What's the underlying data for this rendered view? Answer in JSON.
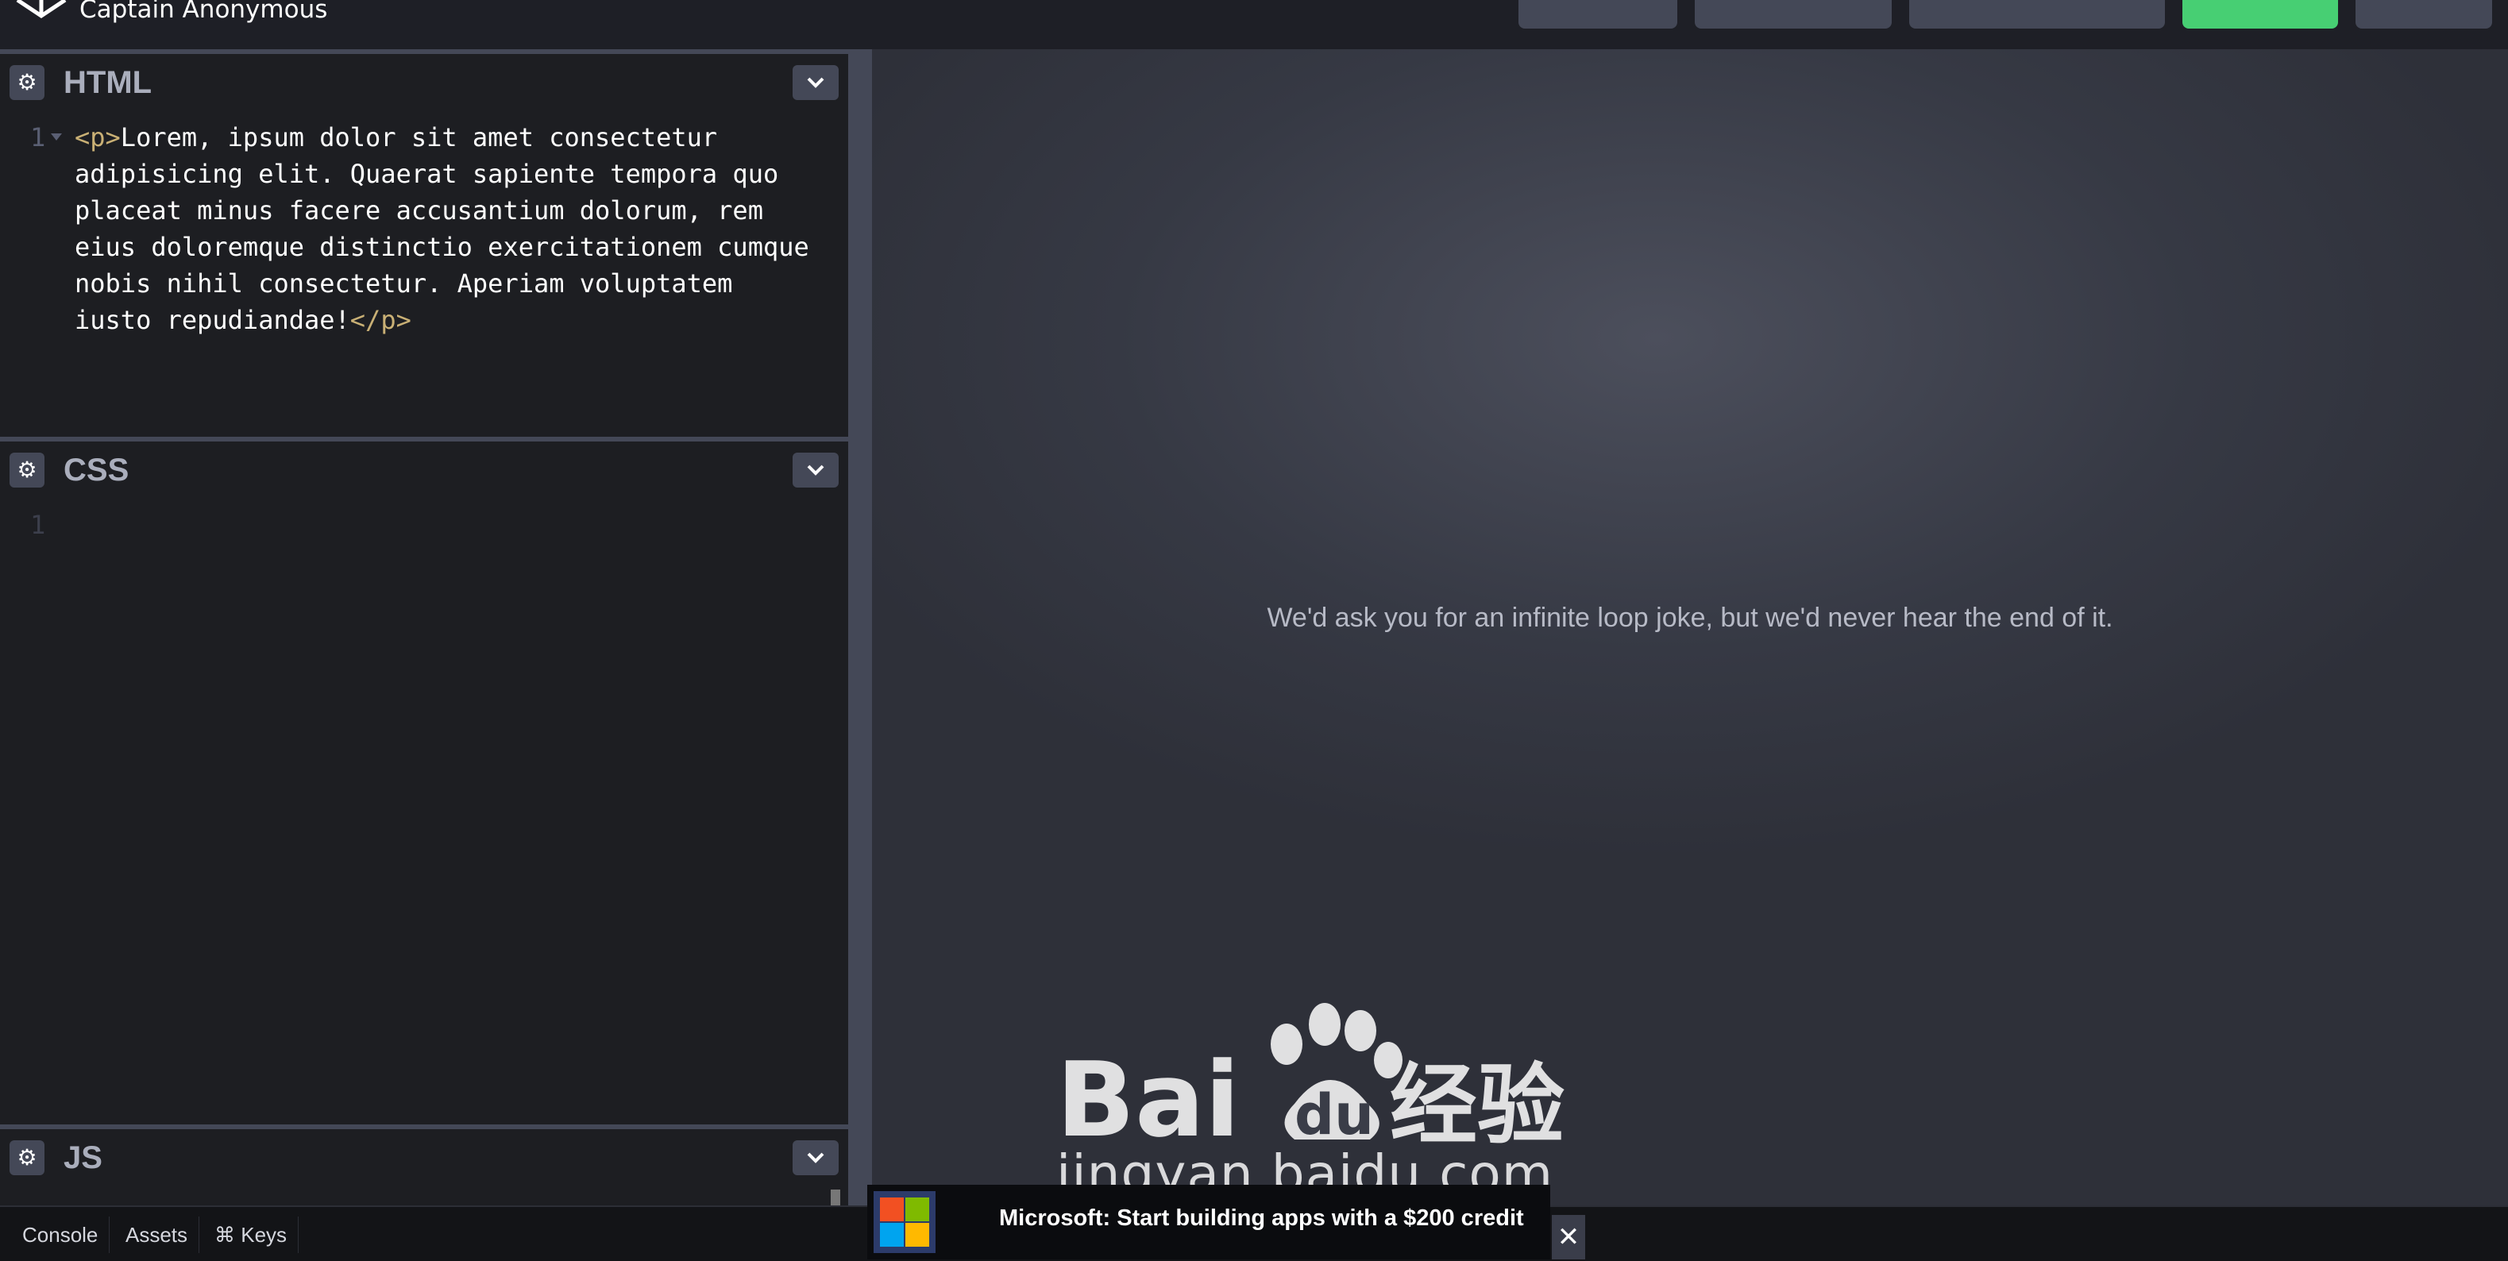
{
  "topbar": {
    "author": "Captain Anonymous"
  },
  "editors": [
    {
      "title": "HTML",
      "lines": [
        {
          "number": "1",
          "open_tag": "<p>",
          "text": "Lorem, ipsum dolor sit amet consectetur adipisicing elit. Quaerat sapiente tempora quo placeat minus facere accusantium dolorum, rem eius doloremque distinctio exercitationem cumque nobis nihil consectetur. Aperiam voluptatem iusto repudiandae!",
          "close_tag": "</p>"
        }
      ]
    },
    {
      "title": "CSS",
      "lines": [
        {
          "number": "1"
        }
      ]
    },
    {
      "title": "JS"
    }
  ],
  "preview": {
    "message": "We'd ask you for an infinite loop joke, but we'd never hear the end of it."
  },
  "footer": {
    "console": "Console",
    "assets": "Assets",
    "keys": "⌘ Keys"
  },
  "ad": {
    "text": "Microsoft: Start building apps with a $200 credit",
    "close": "✕"
  },
  "watermark": {
    "brand": "Baidu经验",
    "url": "jingyan.baidu.com"
  },
  "icons": {
    "gear": "⚙",
    "chevron": "chevron-down-icon",
    "logo": "codepen-logo-icon"
  },
  "colors": {
    "accent_green": "#47cf73",
    "panel_bg": "#1d1e22",
    "button_bg": "#444857",
    "tag_color": "#c9b075"
  }
}
